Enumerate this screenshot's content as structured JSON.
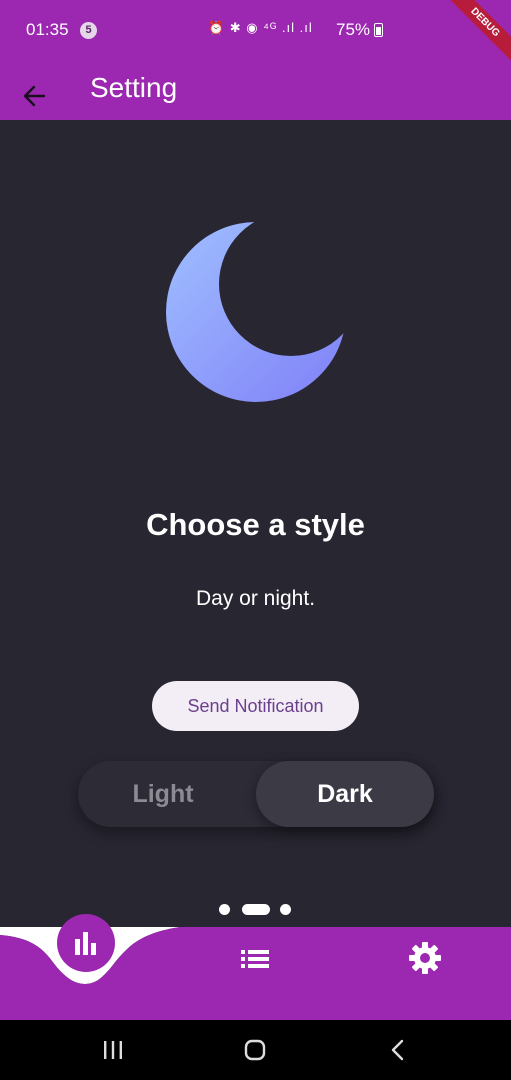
{
  "status_bar": {
    "time": "01:35",
    "notification_count": "5",
    "icons": "⏰ ✱ ◉ ⁴ᴳ .ıl .ıl",
    "battery": "75%"
  },
  "debug_banner": "DEBUG",
  "app_bar": {
    "title": "Setting",
    "back_icon": "arrow-left-icon"
  },
  "hero": {
    "icon": "moon-icon",
    "title": "Choose a style",
    "subtitle": "Day or night."
  },
  "send_button": {
    "label": "Send Notification"
  },
  "theme_toggle": {
    "options": [
      "Light",
      "Dark"
    ],
    "selected": "Dark"
  },
  "page_indicator": {
    "count": 3,
    "active_index": 1
  },
  "bottom_nav": {
    "items": [
      {
        "icon": "bar-chart-icon",
        "selected": true
      },
      {
        "icon": "list-icon",
        "selected": false
      },
      {
        "icon": "gear-icon",
        "selected": false
      }
    ]
  },
  "system_nav": {
    "icons": [
      "recents-icon",
      "home-icon",
      "back-icon"
    ]
  },
  "colors": {
    "primary": "#9c27b0",
    "background": "#272631",
    "moon_gradient_start": "#a0c0ff",
    "moon_gradient_end": "#7f7ff7",
    "button_text": "#6a3f8c"
  }
}
